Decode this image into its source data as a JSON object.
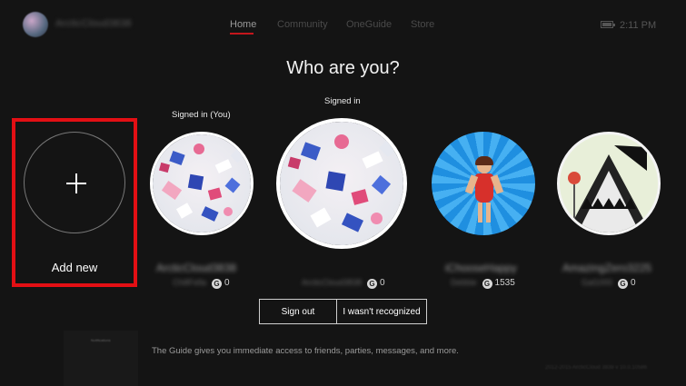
{
  "header": {
    "gamertag": "ArcticCloud3838",
    "tabs": [
      {
        "label": "Home",
        "active": true
      },
      {
        "label": "Community",
        "active": false
      },
      {
        "label": "OneGuide",
        "active": false
      },
      {
        "label": "Store",
        "active": false
      }
    ],
    "time": "2:11 PM"
  },
  "title": "Who are you?",
  "add_new": {
    "label": "Add new"
  },
  "profiles": [
    {
      "status": "Signed in  (You)",
      "gamertag": "ArcticCloud3838",
      "subtitle": "ChillFella",
      "score": "0",
      "avatar": "confetti-avatar"
    },
    {
      "status": "Signed in",
      "gamertag": "",
      "subtitle": "ArcticCloud3838",
      "score": "0",
      "avatar": "confetti-avatar"
    },
    {
      "status": "",
      "gamertag": "iChooseHappy",
      "subtitle": "Debbie",
      "score": "1535",
      "avatar": "avatar-on-blue"
    },
    {
      "status": "",
      "gamertag": "AmazingZero3225",
      "subtitle": "Gal1000",
      "score": "0",
      "avatar": "shark-mountain-avatar"
    }
  ],
  "buttons": {
    "sign_out": "Sign out",
    "not_recognized": "I wasn't recognized"
  },
  "guide": {
    "small_text": "Notifications",
    "text": "The Guide gives you immediate access to friends, parties, messages, and more."
  },
  "footer": "2012-2015 ArcticCloud 3838 v 10.0.10586"
}
